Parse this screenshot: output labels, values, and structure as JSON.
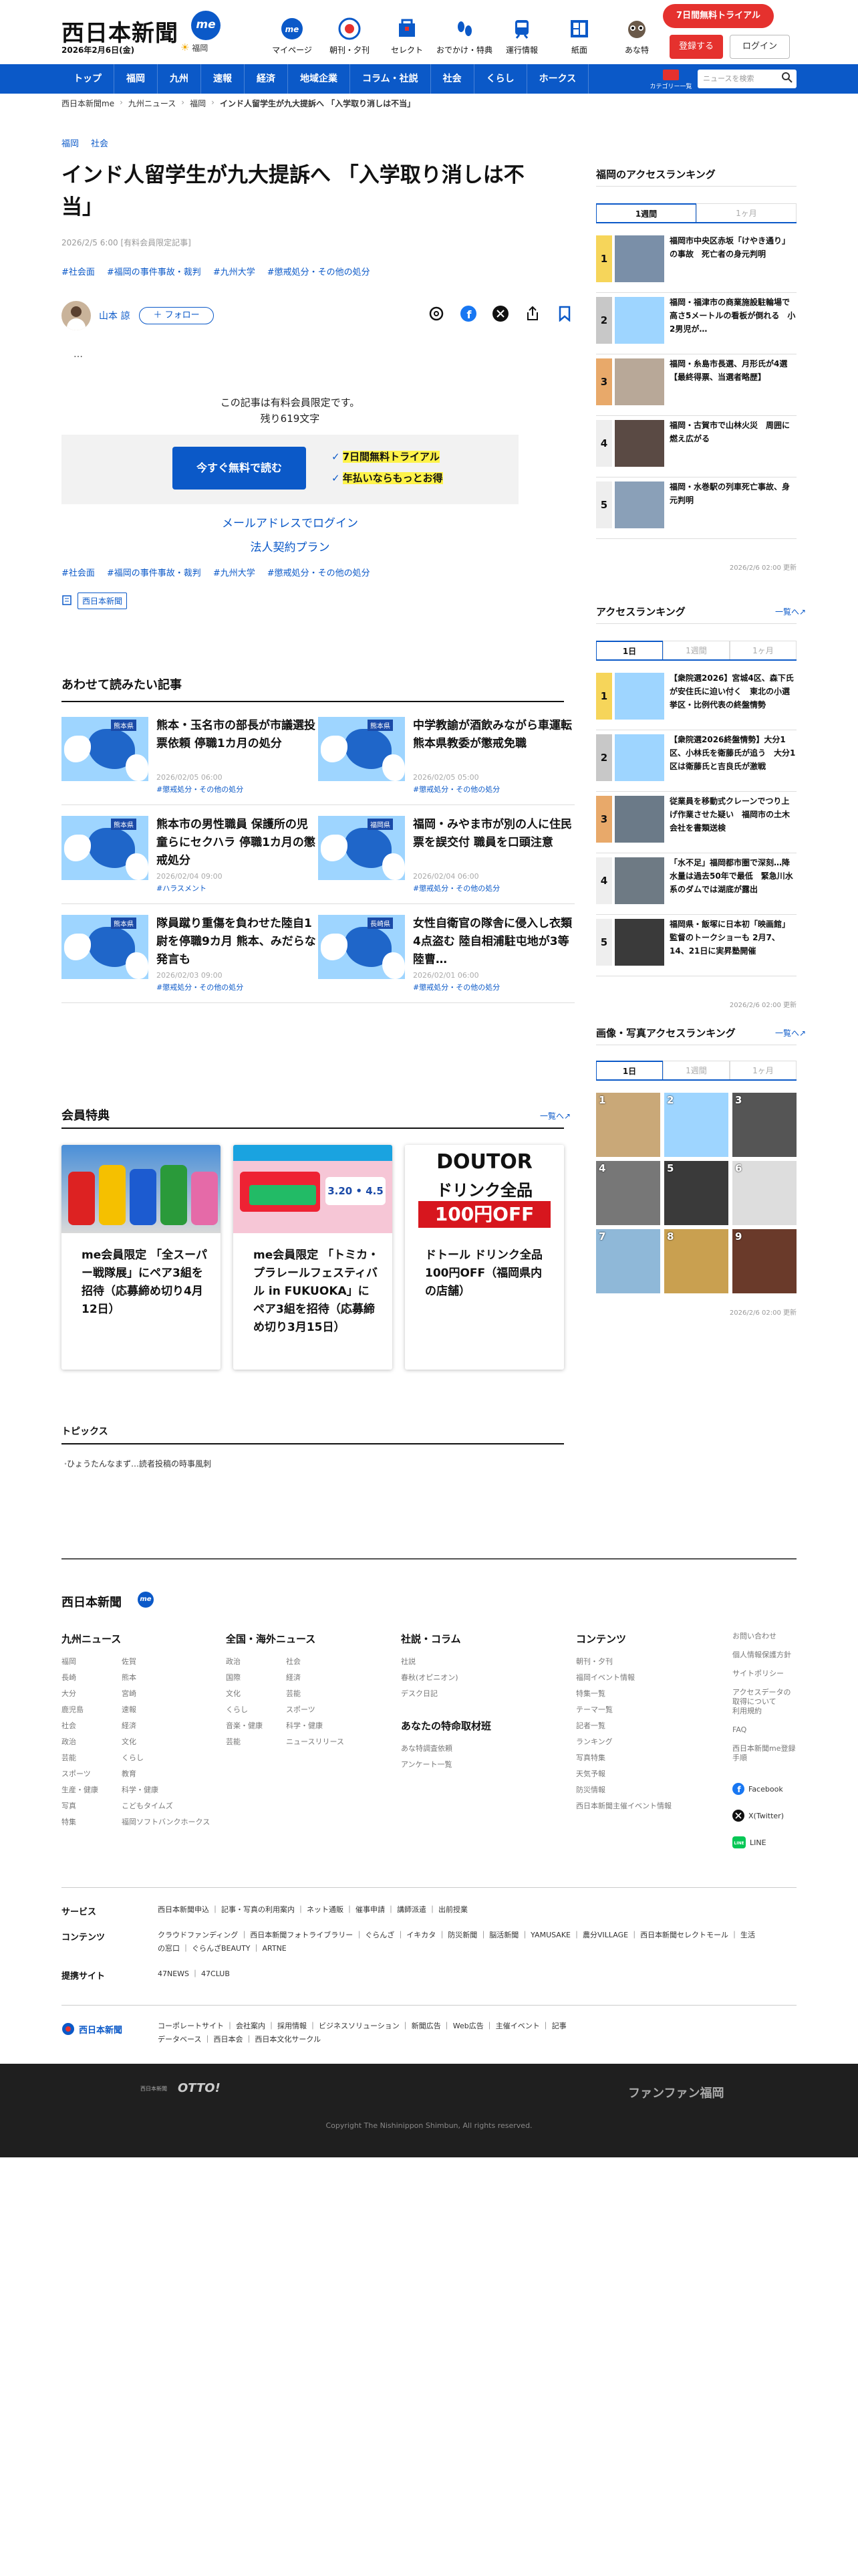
{
  "header": {
    "logo": "西日本新聞",
    "logo_badge": "me",
    "date": "2026年2月6日(金)",
    "weather_area": "福岡",
    "nav_icons": [
      {
        "label": "マイページ",
        "icon": "me-icon"
      },
      {
        "label": "朝刊・夕刊",
        "icon": "newspaper-icon"
      },
      {
        "label": "セレクト",
        "icon": "select-icon"
      },
      {
        "label": "おでかけ・特典",
        "icon": "outing-icon"
      },
      {
        "label": "運行情報",
        "icon": "train-icon"
      },
      {
        "label": "紙面",
        "icon": "paper-icon"
      },
      {
        "label": "あな特",
        "icon": "raccoon-icon"
      }
    ],
    "trial": "7日間無料トライアル",
    "register": "登録する",
    "login": "ログイン"
  },
  "gnav": {
    "items": [
      "トップ",
      "福岡",
      "九州",
      "速報",
      "経済",
      "地域企業",
      "コラム・社説",
      "社会",
      "くらし",
      "ホークス"
    ],
    "category": "カテゴリー一覧",
    "search_placeholder": "ニュースを検索"
  },
  "breadcrumb": [
    "西日本新聞me",
    "九州ニュース",
    "福岡",
    "インド人留学生が九大提訴へ 「入学取り消しは不当」"
  ],
  "article": {
    "categories": [
      "福岡",
      "社会"
    ],
    "title": "インド人留学生が九大提訴へ 「入学取り消しは不当」",
    "meta": "2026/2/5 6:00 [有料会員限定記事]",
    "tags": [
      "#社会面",
      "#福岡の事件事故・裁判",
      "#九州大学",
      "#懲戒処分・その他の処分"
    ],
    "author": "山本 諒",
    "follow": "＋ フォロー",
    "ellipsis": "…",
    "paywall_line1": "この記事は有料会員限定です。",
    "paywall_line2": "残り619文字",
    "cta": "今すぐ無料で読む",
    "check1": "7日間無料トライアル",
    "check2": "年払いならもっとお得",
    "mail_login": "メールアドレスでログイン",
    "corp_plan": "法人契約プラン",
    "tags2": [
      "#社会面",
      "#福岡の事件事故・裁判",
      "#九州大学",
      "#懲戒処分・その他の処分"
    ],
    "source": "西日本新聞"
  },
  "related": {
    "title": "あわせて読みたい記事",
    "items": [
      {
        "title": "熊本・玉名市の部長が市議選投票依頼 停職1カ月の処分",
        "date": "2026/02/05 06:00",
        "tag": "#懲戒処分・その他の処分",
        "label": "熊本県"
      },
      {
        "title": "中学教諭が酒飲みながら車運転 熊本県教委が懲戒免職",
        "date": "2026/02/05 05:00",
        "tag": "#懲戒処分・その他の処分",
        "label": "熊本県"
      },
      {
        "title": "熊本市の男性職員 保護所の児童らにセクハラ 停職1カ月の懲戒処分",
        "date": "2026/02/04 09:00",
        "tag": "#ハラスメント",
        "label": "熊本県"
      },
      {
        "title": "福岡・みやま市が別の人に住民票を誤交付 職員を口頭注意",
        "date": "2026/02/04 06:00",
        "tag": "#懲戒処分・その他の処分",
        "label": "福岡県"
      },
      {
        "title": "隊員蹴り重傷を負わせた陸自1尉を停職9カ月 熊本、みだらな発言も",
        "date": "2026/02/03 09:00",
        "tag": "#懲戒処分・その他の処分",
        "label": "熊本県"
      },
      {
        "title": "女性自衛官の隊舎に侵入し衣類4点盗む 陸自相浦駐屯地が3等陸曹…",
        "date": "2026/02/01 06:00",
        "tag": "#懲戒処分・その他の処分",
        "label": "長崎県"
      }
    ]
  },
  "benefits": {
    "title": "会員特典",
    "more": "一覧へ",
    "items": [
      {
        "title": "me会員限定 「全スーパー戦隊展」にペア3組を招待（応募締め切り4月12日）"
      },
      {
        "title": "me会員限定 「トミカ・プラレールフェスティバル in FUKUOKA」にペア3組を招待（応募締め切り3月15日）"
      },
      {
        "title": "ドトール ドリンク全品100円OFF（福岡県内の店舗）"
      }
    ],
    "doutor_brand": "DOUTOR",
    "doutor_text1": "ドリンク全品",
    "doutor_text2": "100円OFF",
    "tomica_dates": "3.20 • 4.5"
  },
  "topics": {
    "title": "トピックス",
    "item": "ひょうたんなまず…読者投稿の時事風刺"
  },
  "sidebar": {
    "fukuoka_rank": {
      "title": "福岡のアクセスランキング",
      "tabs": [
        "1週間",
        "1ヶ月"
      ],
      "items": [
        "福岡市中央区赤坂「けやき通り」の事故　死亡者の身元判明",
        "福岡・福津市の商業施設駐輪場で高さ5メートルの看板が倒れる　小2男児が…",
        "福岡・糸島市長選、月形氏が4選【最終得票、当選者略歴】",
        "福岡・古賀市で山林火災　周囲に燃え広がる",
        "福岡・水巻駅の列車死亡事故、身元判明"
      ],
      "updated": "2026/2/6 02:00 更新"
    },
    "access_rank": {
      "title": "アクセスランキング",
      "more": "一覧へ",
      "tabs": [
        "1日",
        "1週間",
        "1ヶ月"
      ],
      "items": [
        "【衆院選2026】宮城4区、森下氏が安住氏に迫い付く　東北の小選挙区・比例代表の終盤情勢",
        "【衆院選2026終盤情勢】大分1区、小林氏を衛藤氏が追う　大分1区は衛藤氏と吉良氏が激戦",
        "従業員を移動式クレーンでつり上げ作業させた疑い　福岡市の土木会社を書類送検",
        "「水不足」福岡都市圏で深刻…降水量は過去50年で最低　緊急川水系のダムでは湖底が露出",
        "福岡県・飯塚に日本初「映画館」 監督のトークショーも 2月7、14、21日に実昇塾開催"
      ],
      "updated": "2026/2/6 02:00 更新"
    },
    "photo_rank": {
      "title": "画像・写真アクセスランキング",
      "more": "一覧へ",
      "tabs": [
        "1日",
        "1週間",
        "1ヶ月"
      ],
      "nums": [
        "1",
        "2",
        "3",
        "4",
        "5",
        "6",
        "7",
        "8",
        "9"
      ],
      "updated": "2026/2/6 02:00 更新"
    }
  },
  "footer": {
    "logo": "西日本新聞",
    "cols": [
      {
        "title": "九州ニュース",
        "links": [
          "福岡",
          "長崎",
          "大分",
          "鹿児島",
          "社会",
          "政治",
          "芸能",
          "スポーツ",
          "生産・健康",
          "写真",
          "特集",
          "佐賀",
          "熊本",
          "宮崎",
          "速報",
          "経済",
          "文化",
          "くらし",
          "教育",
          "科学・健康",
          "こどもタイムズ",
          "福岡ソフトバンクホークス"
        ]
      },
      {
        "title": "全国・海外ニュース",
        "links": [
          "政治",
          "国際",
          "文化",
          "くらし",
          "音楽・健康",
          "芸能",
          "社会",
          "経済",
          "芸能",
          "スポーツ",
          "科学・健康",
          "ニュースリリース"
        ]
      },
      {
        "title": "社説・コラム",
        "links": [
          "社説",
          "春秋(オピニオン)",
          "デスク日記"
        ]
      },
      {
        "title": "あなたの特命取材班",
        "links": [
          "あな特調査依頼",
          "アンケート一覧"
        ]
      },
      {
        "title": "コンテンツ",
        "links": [
          "朝刊・夕刊",
          "福岡イベント情報",
          "特集一覧",
          "テーマ一覧",
          "記者一覧",
          "ランキング",
          "写真特集",
          "天気予報",
          "防災情報",
          "西日本新聞主催イベント情報"
        ]
      }
    ],
    "right_links": [
      "お問い合わせ",
      "個人情報保護方針",
      "サイトポリシー",
      "アクセスデータの取得について",
      "利用規約",
      "FAQ",
      "西日本新聞me登録手順"
    ],
    "social": [
      "Facebook",
      "X(Twitter)",
      "LINE"
    ],
    "services_label": "サービス",
    "services": "西日本新聞申込 ｜ 記事・写真の利用案内 ｜ ネット通販 ｜ 催事申請 ｜ 講師派遣 ｜ 出前授業",
    "contents_label": "コンテンツ",
    "contents": "クラウドファンディング ｜ 西日本新聞フォトライブラリー ｜ ぐらんざ ｜ イキカタ ｜ 防災新聞 ｜ 脳活新聞 ｜ YAMUSAKE ｜ 農分VILLAGE ｜ 西日本新聞セレクトモール ｜ 生活の窓口 ｜ ぐらんざBEAUTY ｜ ARTNE",
    "partner_label": "提携サイト",
    "partners": "47NEWS ｜ 47CLUB",
    "corp_logo": "西日本新聞",
    "corp_links": "コーポレートサイト ｜ 会社案内 ｜ 採用情報 ｜ ビジネスソリューション ｜ 新聞広告 ｜ Web広告 ｜ 主催イベント ｜ 記事データベース ｜ 西日本会 ｜ 西日本文化サークル",
    "otto": "OTTO!",
    "otto_sub": "西日本新聞",
    "fanfan": "ファンファン福岡",
    "copyright": "Copyright The Nishinippon Shimbun, All rights reserved."
  },
  "colors": {
    "brand_blue": "#0b59c8",
    "accent_red": "#e5312e",
    "highlight": "#fff34a"
  }
}
